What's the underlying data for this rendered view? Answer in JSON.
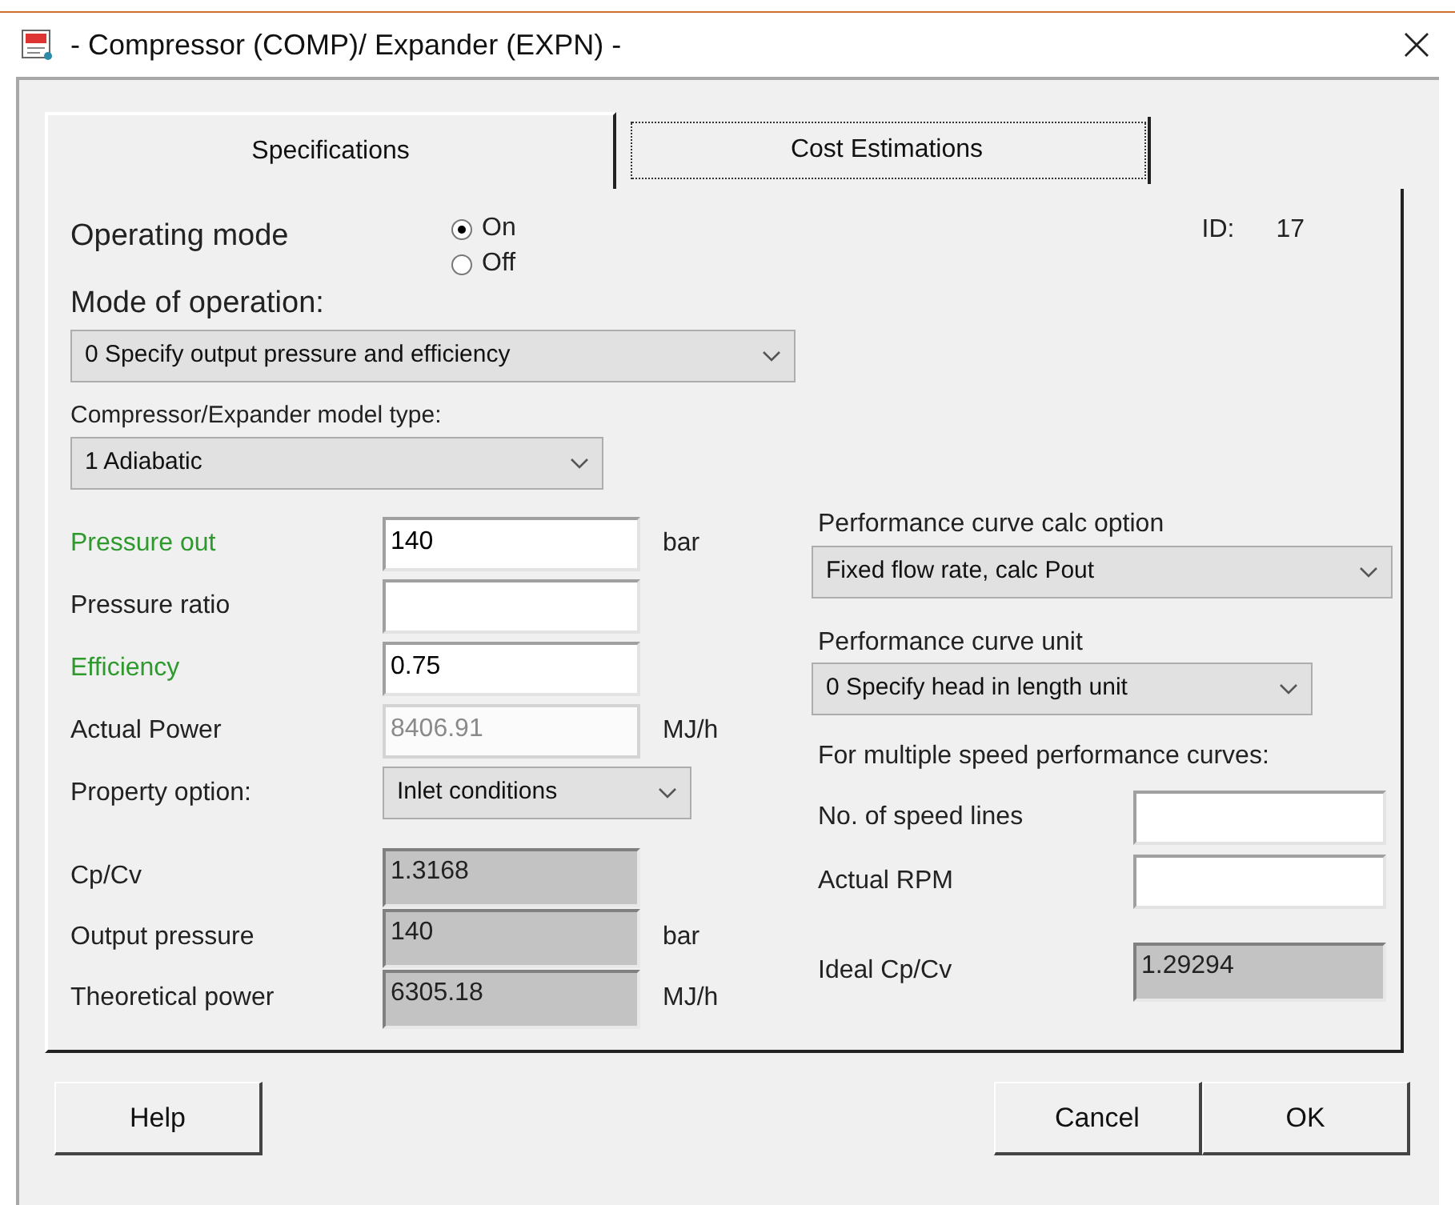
{
  "window": {
    "title": "- Compressor (COMP)/ Expander (EXPN) -"
  },
  "tabs": [
    {
      "label": "Specifications",
      "selected": true
    },
    {
      "label": "Cost Estimations",
      "selected": false
    }
  ],
  "operating_mode": {
    "label": "Operating mode",
    "options": [
      {
        "label": "On",
        "selected": true
      },
      {
        "label": "Off",
        "selected": false
      }
    ]
  },
  "id": {
    "label": "ID:",
    "value": "17"
  },
  "mode_of_operation": {
    "label": "Mode of operation:",
    "value": "0 Specify output pressure and efficiency"
  },
  "model_type": {
    "label": "Compressor/Expander model type:",
    "value": "1 Adiabatic"
  },
  "fields": [
    {
      "kind": "input",
      "label": "Pressure out",
      "value": "140",
      "unit": "bar",
      "required": true,
      "disabled": false
    },
    {
      "kind": "input",
      "label": "Pressure ratio",
      "required": false,
      "disabled": false
    },
    {
      "kind": "input",
      "label": "Efficiency",
      "value": "0.75",
      "required": true,
      "disabled": false
    },
    {
      "kind": "input",
      "label": "Actual Power",
      "value": "8406.91",
      "unit": "MJ/h",
      "required": false,
      "disabled": true
    },
    {
      "kind": "select",
      "label": "Property option:",
      "value": "Inlet conditions",
      "required": false
    },
    {
      "kind": "readonly",
      "label": "Cp/Cv",
      "value": "1.3168",
      "required": false
    },
    {
      "kind": "readonly",
      "label": "Output pressure",
      "value": "140",
      "unit": "bar",
      "required": false
    },
    {
      "kind": "readonly",
      "label": "Theoretical power",
      "value": "6305.18",
      "unit": "MJ/h",
      "required": false
    }
  ],
  "performance": {
    "calc_option": {
      "label": "Performance curve calc option",
      "value": "Fixed flow rate, calc Pout"
    },
    "unit": {
      "label": "Performance curve unit",
      "value": "0  Specify head in length unit"
    },
    "multi_speed_label": "For multiple speed performance curves:",
    "fields": [
      {
        "kind": "input",
        "label": "No. of speed lines"
      },
      {
        "kind": "input",
        "label": "Actual RPM"
      },
      {
        "kind": "readonly",
        "label": "Ideal Cp/Cv",
        "value": "1.29294"
      }
    ]
  },
  "buttons": [
    {
      "label": "Help"
    },
    {
      "label": "Cancel"
    },
    {
      "label": "OK"
    }
  ]
}
